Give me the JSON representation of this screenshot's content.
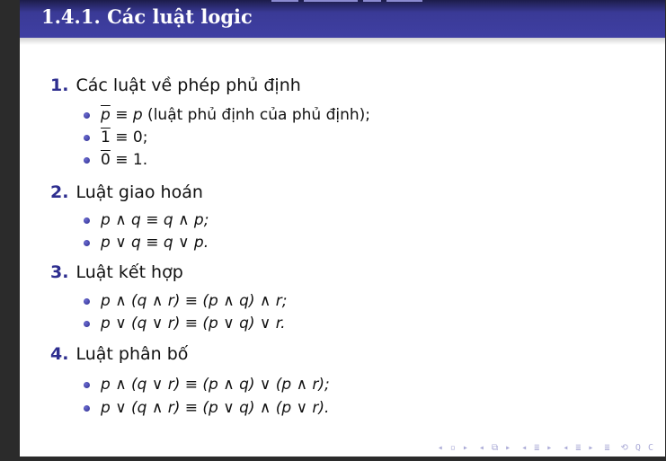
{
  "title": "1.4.1. Các luật logic",
  "sections": [
    {
      "num": "1.",
      "label": "Các luật về phép phủ định",
      "items": [
        {
          "lead": "p",
          "rest": " ≡ ",
          "tail": "p",
          "note": " (luật phủ định của phủ định);"
        },
        {
          "lead": "1",
          "rest": " ≡ 0;",
          "tail": "",
          "note": ""
        },
        {
          "lead": "0",
          "rest": " ≡ 1.",
          "tail": "",
          "note": ""
        }
      ]
    },
    {
      "num": "2.",
      "label": "Luật giao hoán",
      "items": [
        "p ∧ q ≡ q ∧ p;",
        "p ∨ q ≡ q ∨ p."
      ]
    },
    {
      "num": "3.",
      "label": "Luật kết hợp",
      "items": [
        "p ∧ (q ∧ r) ≡ (p ∧ q) ∧ r;",
        "p ∨ (q ∨ r) ≡ (p ∨ q) ∨ r."
      ]
    },
    {
      "num": "4.",
      "label": "Luật phân bố",
      "items": [
        "p ∧ (q ∨ r) ≡ (p ∧ q) ∨ (p ∧ r);",
        "p ∨ (q ∧ r) ≡ (p ∨ q) ∧ (p ∨ r)."
      ]
    }
  ],
  "nav": [
    "◂ ▫ ▸",
    "◂ ⧉ ▸",
    "◂ ≣ ▸",
    "◂ ≣ ▸",
    "≣",
    "⟲ Q C"
  ]
}
